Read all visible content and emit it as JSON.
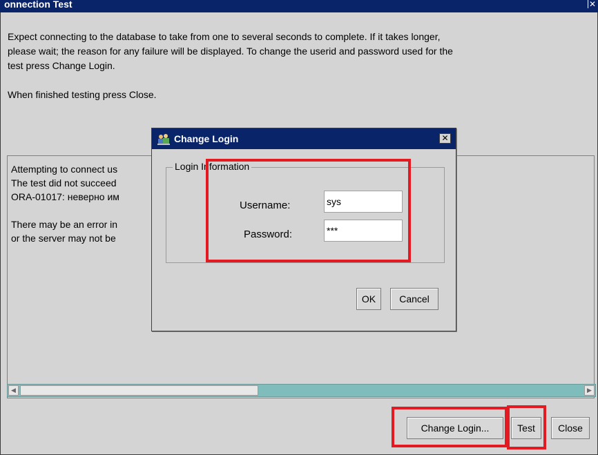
{
  "window": {
    "title": "onnection Test",
    "close_glyph": "✕"
  },
  "instructions": {
    "line1": "Expect connecting to the database to take from one to several seconds to complete. If it takes longer,",
    "line2": "please wait; the reason for any failure will be displayed. To change the userid and password used for the",
    "line3": "test press Change Login.",
    "line4": "When finished testing press Close."
  },
  "result": {
    "text": "Attempting to connect us\nThe test did not succeed\nORA-01017: неверно им                                                                              я\n\nThere may be an error in\nor the server may not be"
  },
  "buttons": {
    "change_login": "Change Login...",
    "test": "Test",
    "close": "Close"
  },
  "dialog": {
    "title": "Change Login",
    "close_glyph": "✕",
    "group_label": "Login Information",
    "username_label": "Username:",
    "username_value": "sys",
    "password_label": "Password:",
    "password_value": "***",
    "ok_label": "OK",
    "cancel_label": "Cancel"
  },
  "colors": {
    "titlebar": "#0a246a",
    "highlight": "#e41a22",
    "scrollbar": "#7fbcbc"
  }
}
